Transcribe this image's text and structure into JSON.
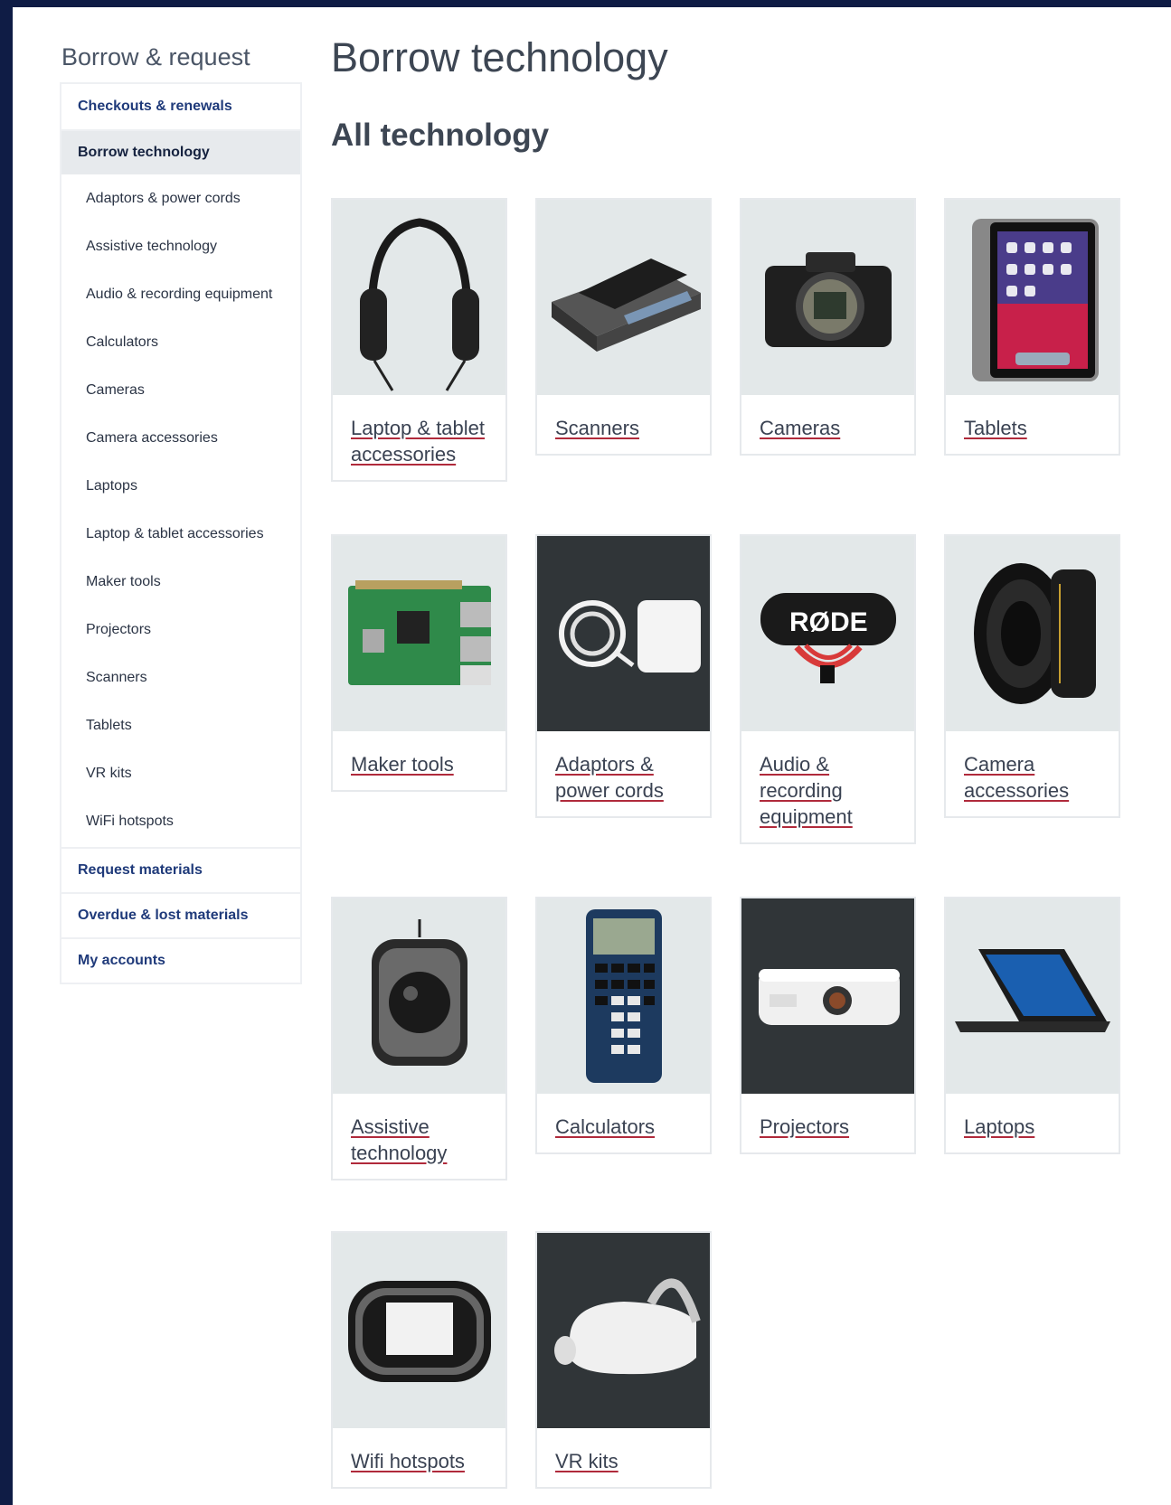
{
  "sidebar": {
    "title": "Borrow & request",
    "top_items": [
      {
        "label": "Checkouts & renewals"
      },
      {
        "label": "Borrow technology"
      }
    ],
    "sub_items": [
      "Adaptors & power cords",
      "Assistive technology",
      "Audio & recording equipment",
      "Calculators",
      "Cameras",
      "Camera accessories",
      "Laptops",
      "Laptop & tablet accessories",
      "Maker tools",
      "Projectors",
      "Scanners",
      "Tablets",
      "VR kits",
      "WiFi hotspots"
    ],
    "bottom_items": [
      {
        "label": "Request materials"
      },
      {
        "label": "Overdue & lost materials"
      },
      {
        "label": "My accounts"
      }
    ]
  },
  "main": {
    "page_title": "Borrow technology",
    "section_title": "All technology",
    "cards": [
      {
        "label": "Laptop & tablet accessories",
        "icon": "headphones-icon"
      },
      {
        "label": "Scanners",
        "icon": "scanner-icon"
      },
      {
        "label": "Cameras",
        "icon": "camera-icon"
      },
      {
        "label": "Tablets",
        "icon": "tablet-icon"
      },
      {
        "label": "Maker tools",
        "icon": "circuit-board-icon"
      },
      {
        "label": "Adaptors & power cords",
        "icon": "power-adapter-icon"
      },
      {
        "label": "Audio & recording equipment",
        "icon": "microphone-icon"
      },
      {
        "label": "Camera accessories",
        "icon": "camera-lens-icon"
      },
      {
        "label": "Assistive technology",
        "icon": "trackball-icon"
      },
      {
        "label": "Calculators",
        "icon": "calculator-icon"
      },
      {
        "label": "Projectors",
        "icon": "projector-icon"
      },
      {
        "label": "Laptops",
        "icon": "laptop-icon"
      },
      {
        "label": "Wifi hotspots",
        "icon": "wifi-hotspot-icon"
      },
      {
        "label": "VR kits",
        "icon": "vr-headset-icon"
      }
    ]
  },
  "colors": {
    "background": "#0f1c45",
    "link_underline": "#b02a3b",
    "nav_text": "#1f3a7a"
  }
}
